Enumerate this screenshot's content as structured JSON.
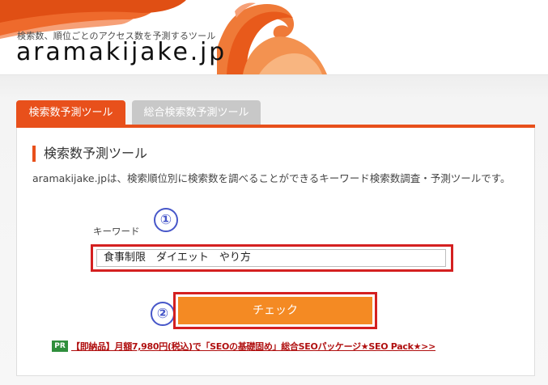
{
  "header": {
    "tagline": "検索数、順位ごとのアクセス数を予測するツール",
    "logo": "aramakijake.jp"
  },
  "tabs": [
    {
      "label": "検索数予測ツール",
      "active": true
    },
    {
      "label": "総合検索数予測ツール",
      "active": false
    }
  ],
  "main": {
    "section_title": "検索数予測ツール",
    "description": "aramakijake.jpは、検索順位別に検索数を調べることができるキーワード検索数調査・予測ツールです。",
    "keyword_label": "キーワード",
    "keyword_value": "食事制限　ダイエット　やり方",
    "check_label": "チェック",
    "marker_1": "①",
    "marker_2": "②"
  },
  "pr": {
    "badge": "PR",
    "link": "【即納品】月額7,980円(税込)で「SEOの基礎固め」総合SEOパッケージ★SEO Pack★>>"
  },
  "colors": {
    "brand_orange": "#e8501b",
    "button_orange": "#f48a23",
    "highlight_red": "#d42020",
    "marker_blue": "#4757c9",
    "pr_green": "#2f8e3c"
  }
}
